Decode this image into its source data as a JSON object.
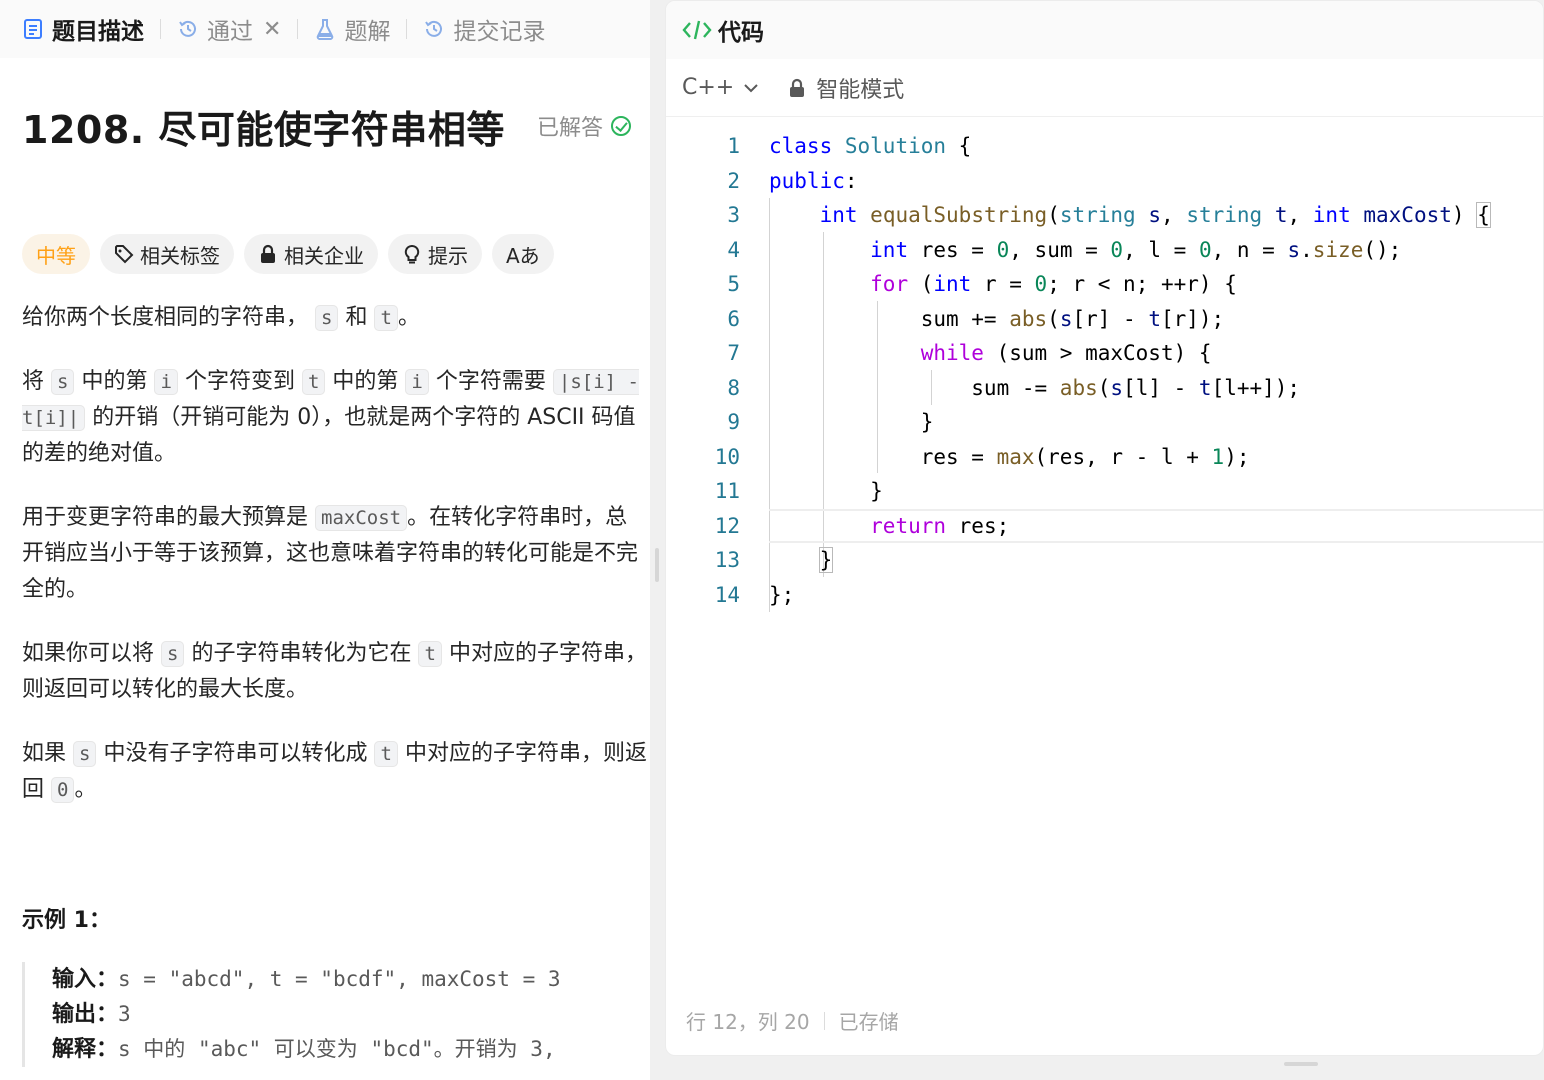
{
  "tabs": [
    {
      "label": "题目描述",
      "icon": "document-icon",
      "active": true
    },
    {
      "label": "通过",
      "icon": "history-icon",
      "closable": true
    },
    {
      "label": "题解",
      "icon": "flask-icon"
    },
    {
      "label": "提交记录",
      "icon": "history-icon"
    }
  ],
  "problem": {
    "title": "1208. 尽可能使字符串相等",
    "status": "已解答"
  },
  "tags": {
    "difficulty": "中等",
    "related_tags": "相关标签",
    "related_companies": "相关企业",
    "hint": "提示",
    "font_toggle": "Aあ"
  },
  "description": {
    "p1": {
      "a": "给你两个长度相同的字符串，",
      "s": "s",
      "b": "和",
      "t": "t",
      "c": "。"
    },
    "p2": {
      "a": "将",
      "s": "s",
      "b": "中的第",
      "i1": "i",
      "c": "个字符变到",
      "t": "t",
      "d": "中的第",
      "i2": "i",
      "e": "个字符需要",
      "expr": "|s[i] - t[i]|",
      "f": "的开销（开销可能为 0），也就是两个字符的 ASCII 码值的差的绝对值。"
    },
    "p3": {
      "a": "用于变更字符串的最大预算是",
      "max": "maxCost",
      "b": "。在转化字符串时，总开销应当小于等于该预算，这也意味着字符串的转化可能是不完全的。"
    },
    "p4": {
      "a": "如果你可以将",
      "s": "s",
      "b": "的子字符串转化为它在",
      "t": "t",
      "c": "中对应的子字符串，则返回可以转化的最大长度。"
    },
    "p5": {
      "a": "如果",
      "s": "s",
      "b": "中没有子字符串可以转化成",
      "t": "t",
      "c": "中对应的子字符串，则返回",
      "zero": "0",
      "d": "。"
    }
  },
  "example": {
    "title": "示例 1：",
    "input_label": "输入：",
    "input_value": "s = \"abcd\", t = \"bcdf\", maxCost = 3",
    "output_label": "输出：",
    "output_value": "3",
    "explain_label": "解释：",
    "explain_value": "s 中的 \"abc\" 可以变为 \"bcd\"。开销为 3,"
  },
  "code_panel": {
    "title": "代码",
    "language": "C++",
    "mode": "智能模式",
    "status_position": "行 12，列 20",
    "status_saved": "已存储"
  },
  "code_lines": [
    "1",
    "2",
    "3",
    "4",
    "5",
    "6",
    "7",
    "8",
    "9",
    "10",
    "11",
    "12",
    "13",
    "14"
  ],
  "colors": {
    "accent_difficulty": "#ffa116",
    "solved_green": "#2db55d",
    "line_number": "#237893",
    "keyword": "#0000ff",
    "type": "#267f99",
    "control": "#af00db",
    "function": "#795e26",
    "number": "#098658"
  }
}
